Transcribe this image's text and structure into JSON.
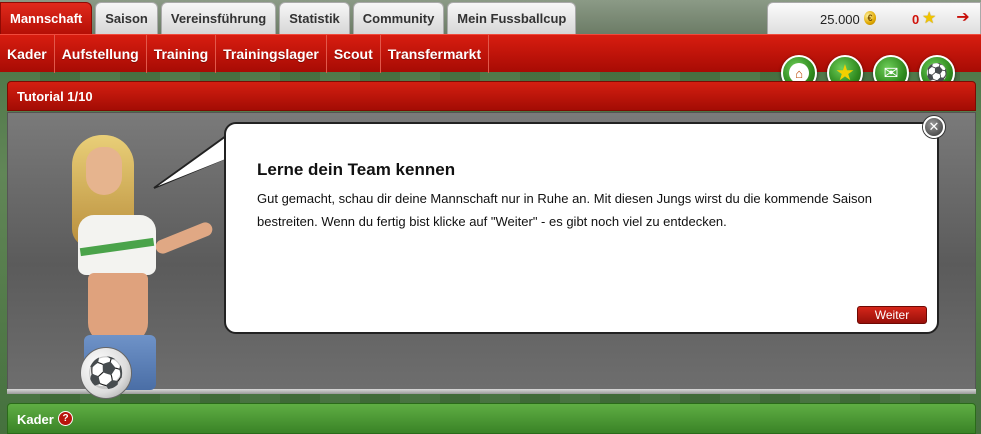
{
  "top_tabs": [
    {
      "label": "Mannschaft",
      "active": true
    },
    {
      "label": "Saison",
      "active": false
    },
    {
      "label": "Vereinsführung",
      "active": false
    },
    {
      "label": "Statistik",
      "active": false
    },
    {
      "label": "Community",
      "active": false
    },
    {
      "label": "Mein Fussballcup",
      "active": false
    }
  ],
  "account": {
    "money": "25.000",
    "currency_icon": "euro-coin-icon",
    "stars": "0",
    "star_icon": "star-icon",
    "logout_icon": "logout-icon"
  },
  "subnav": [
    {
      "label": "Kader"
    },
    {
      "label": "Aufstellung"
    },
    {
      "label": "Training"
    },
    {
      "label": "Trainingslager"
    },
    {
      "label": "Scout"
    },
    {
      "label": "Transfermarkt"
    }
  ],
  "quick_buttons": [
    "home-icon",
    "star-icon",
    "mail-icon",
    "football-icon"
  ],
  "tutorial": {
    "header": "Tutorial 1/10",
    "title": "Lerne dein Team kennen",
    "text": "Gut gemacht, schau dir deine Mannschaft nur in Ruhe an. Mit diesen Jungs wirst du die kommende Saison bestreiten. Wenn du fertig bist klicke auf \"Weiter\" - es gibt noch viel zu entdecken.",
    "button": "Weiter",
    "close_glyph": "✕"
  },
  "kader": {
    "header": "Kader",
    "help_glyph": "?"
  },
  "colors": {
    "red_accent": "#c8140a",
    "green_accent": "#3a8327"
  }
}
